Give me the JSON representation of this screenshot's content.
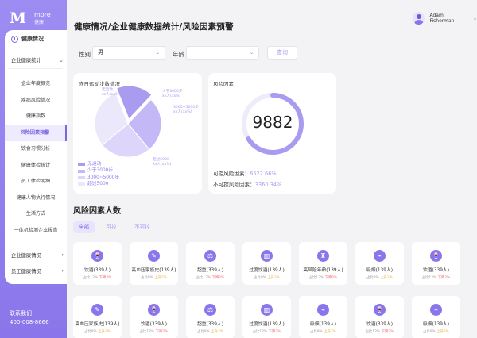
{
  "brand": {
    "mark": "M",
    "word": "more",
    "sub": "健康"
  },
  "sidebar": {
    "top_item": "健康情况",
    "group1": {
      "label": "企业健康统计",
      "chevron": "⌄"
    },
    "items": [
      {
        "label": "企业年度概览",
        "active": false
      },
      {
        "label": "疾病风险情况",
        "active": false
      },
      {
        "label": "健康指数",
        "active": false
      },
      {
        "label": "风险因素预警",
        "active": true
      },
      {
        "label": "饮食习惯分析",
        "active": false
      },
      {
        "label": "健康体检统计",
        "active": false
      },
      {
        "label": "员工体检明细",
        "active": false
      },
      {
        "label": "健康人物执行情况",
        "active": false
      },
      {
        "label": "生活方式",
        "active": false
      },
      {
        "label": "一体机检测企业报告",
        "active": false
      }
    ],
    "group2": {
      "label": "企业健康情况",
      "chevron": "›"
    },
    "group3": {
      "label": "员工健康情况",
      "chevron": "›"
    },
    "contact_label": "联系我们",
    "contact_phone": "400-008-8666"
  },
  "header": {
    "breadcrumb": "健康情况/企业健康数据统计/风险因素预警",
    "user_name": "Adam Fisherman",
    "user_chevron": "⌄"
  },
  "filters": {
    "gender_label": "性别",
    "gender_value": "男",
    "age_label": "年龄",
    "age_value": "",
    "query_button": "查询",
    "arrow": "⌄"
  },
  "steps_card": {
    "title": "昨日运动步数情况",
    "pie_labels": [
      {
        "text": "无运动\nxx人(xx%)"
      },
      {
        "text": "少于3000步\nxx人(xx%)"
      },
      {
        "text": "3000~5000步\nxx人(xx%)"
      },
      {
        "text": "超过5000\nxx人(xx%)"
      }
    ],
    "legend": [
      "无运动",
      "少于3000步",
      "3000~5000步",
      "超过5000"
    ],
    "colors": [
      "#a99cf0",
      "#c4b9f6",
      "#ddd6fa",
      "#ece8fc"
    ]
  },
  "risk_card": {
    "title": "风险因素",
    "total": "9882",
    "controllable_label": "可控风险因素：",
    "controllable_value": "6522 66%",
    "uncontrollable_label": "不可控风险因素：",
    "uncontrollable_value": "3360 34%",
    "controllable_fraction": 0.66
  },
  "population": {
    "title": "风险因素人数",
    "tabs": [
      "全部",
      "可控",
      "不可控"
    ],
    "rows": [
      [
        {
          "icon": "wine-icon",
          "glyph": "🍷",
          "name": "饮酒(339人)",
          "pct": "占比12%",
          "trend": "下降2%",
          "dir": "down"
        },
        {
          "icon": "food-icon",
          "glyph": "✎",
          "name": "高血压家族史(139人)",
          "pct": "占比8%",
          "trend": "上升2%",
          "dir": "up"
        },
        {
          "icon": "weight-icon",
          "glyph": "⚖",
          "name": "超重(339人)",
          "pct": "占比13%",
          "trend": "下降2%",
          "dir": "down"
        },
        {
          "icon": "drink-icon",
          "glyph": "▥",
          "name": "过度饮酒(139人)",
          "pct": "占比8%",
          "trend": "上升2%",
          "dir": "up"
        },
        {
          "icon": "age-icon",
          "glyph": "♜",
          "name": "高风险年龄(139人)",
          "pct": "占比12%",
          "trend": "下降2%",
          "dir": "down"
        },
        {
          "icon": "smoke-icon",
          "glyph": "⌁",
          "name": "吸烟(139人)",
          "pct": "占比8%",
          "trend": "上升2%",
          "dir": "up"
        },
        {
          "icon": "wine-icon",
          "glyph": "🍷",
          "name": "饮酒(339人)",
          "pct": "占比12%",
          "trend": "下降2%",
          "dir": "down"
        }
      ],
      [
        {
          "icon": "food-icon",
          "glyph": "✎",
          "name": "高血压家族史(139人)",
          "pct": "占比8%",
          "trend": "上升2%",
          "dir": "up"
        },
        {
          "icon": "wine-icon",
          "glyph": "🍷",
          "name": "饮酒(339人)",
          "pct": "占比12%",
          "trend": "下降2%",
          "dir": "down"
        },
        {
          "icon": "weight-icon",
          "glyph": "⚖",
          "name": "超重(339人)",
          "pct": "占比8%",
          "trend": "上升2%",
          "dir": "up"
        },
        {
          "icon": "drink-icon",
          "glyph": "▥",
          "name": "过度饮酒(139人)",
          "pct": "占比12%",
          "trend": "下降2%",
          "dir": "down"
        },
        {
          "icon": "smoke-icon",
          "glyph": "⌁",
          "name": "吸烟(139人)",
          "pct": "占比8%",
          "trend": "上升2%",
          "dir": "up"
        },
        {
          "icon": "wine-icon",
          "glyph": "🍷",
          "name": "饮酒(339人)",
          "pct": "占比12%",
          "trend": "下降2%",
          "dir": "down"
        },
        {
          "icon": "smoke-icon",
          "glyph": "⌁",
          "name": "吸烟(139人)",
          "pct": "占比8%",
          "trend": "上升2%",
          "dir": "up"
        }
      ]
    ]
  },
  "accent": "#8a76ea"
}
